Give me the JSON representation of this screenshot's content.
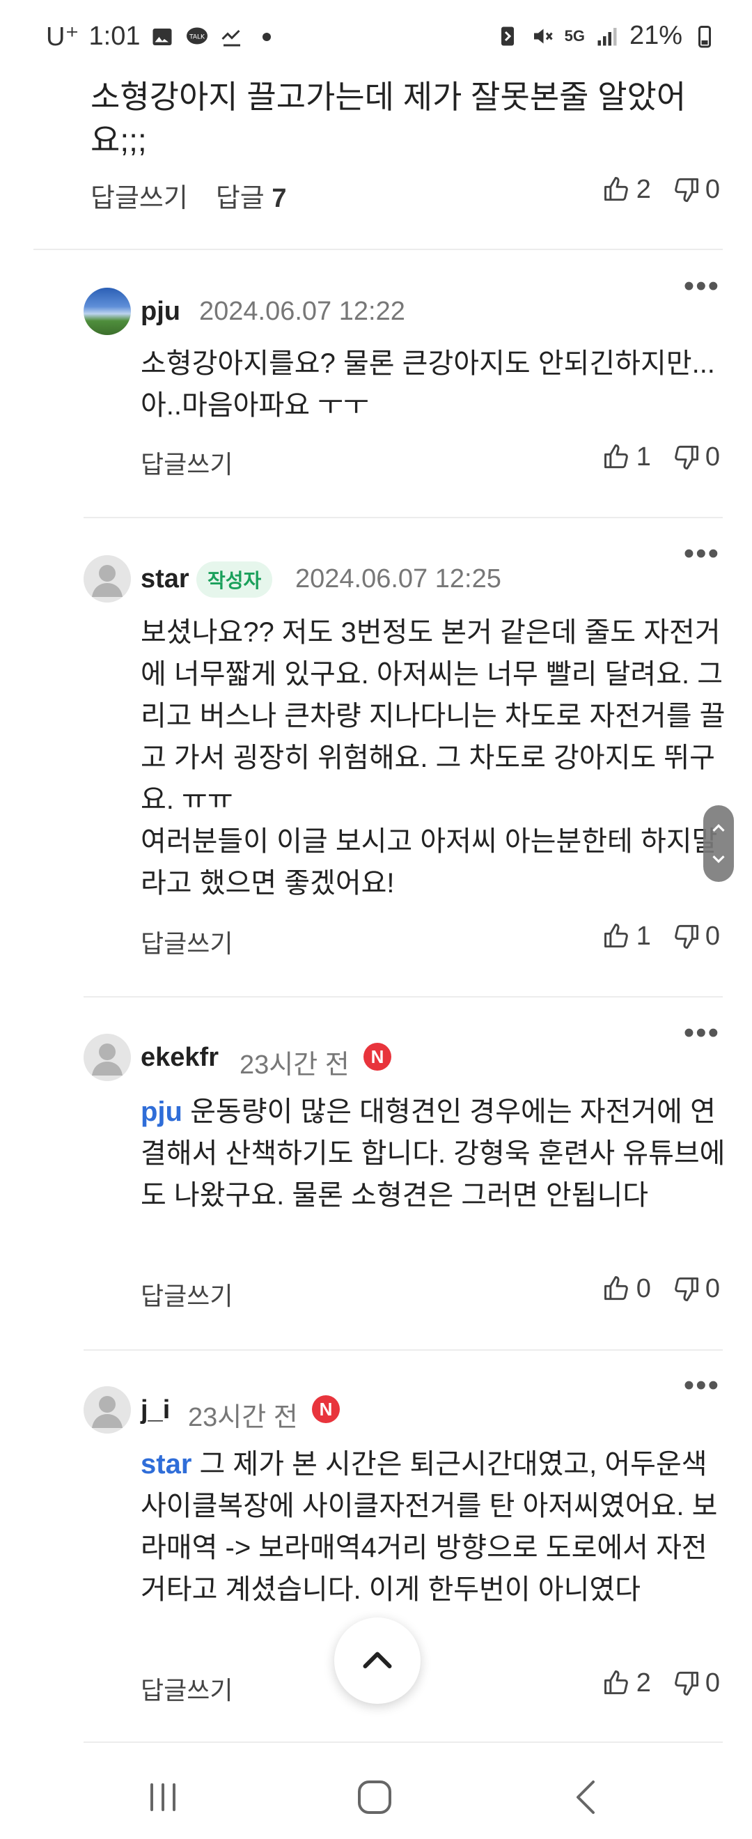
{
  "status": {
    "carrier": "U⁺",
    "time": "1:01",
    "battery": "21%",
    "network": "5G",
    "icons": [
      "image-icon",
      "talk-icon",
      "missed-call-icon",
      "dot-icon",
      "battery-saver-icon",
      "mute-icon",
      "signal-icon",
      "battery-icon"
    ],
    "talk_label": "TALK"
  },
  "top_comment": {
    "text": "소형강아지 끌고가는데 제가 잘못본줄 알았어요;;;",
    "reply_label": "답글쓰기",
    "replies_label": "답글",
    "replies_count": "7",
    "likes": "2",
    "dislikes": "0"
  },
  "comments": [
    {
      "author": "pju",
      "date": "2024.06.07 12:22",
      "text": "소형강아지를요? 물론 큰강아지도 안되긴하지만... 아..마음아파요 ㅜㅜ",
      "reply_label": "답글쓰기",
      "likes": "1",
      "dislikes": "0"
    },
    {
      "author": "star",
      "badge": "작성자",
      "date": "2024.06.07 12:25",
      "text": "보셨나요?? 저도 3번정도 본거 같은데 줄도 자전거에 너무짧게 있구요. 아저씨는 너무 빨리 달려요. 그리고 버스나 큰차량 지나다니는 차도로 자전거를 끌고 가서 굉장히 위험해요. 그 차도로 강아지도 뛰구요. ㅠㅠ",
      "text2": "여러분들이 이글 보시고 아저씨 아는분한테 하지말라고 했으면 좋겠어요!",
      "reply_label": "답글쓰기",
      "likes": "1",
      "dislikes": "0"
    },
    {
      "author": "ekekfr",
      "date": "23시간 전",
      "new": "N",
      "mention": "pju",
      "text": " 운동량이 많은 대형견인 경우에는 자전거에 연결해서 산책하기도 합니다. 강형욱 훈련사 유튜브에도 나왔구요. 물론 소형견은 그러면 안됩니다",
      "reply_label": "답글쓰기",
      "likes": "0",
      "dislikes": "0"
    },
    {
      "author": "j_i",
      "date": "23시간 전",
      "new": "N",
      "mention": "star",
      "text": " 그 제가 본 시간은 퇴근시간대였고, 어두운색 사이클복장에 사이클자전거를 탄 아저씨였어요. 보라매역 -> 보라매역4거리 방향으로 도로에서 자전거타고 계셨습니다. 이게 한두번이 아니였다",
      "reply_label": "답글쓰기",
      "likes": "2",
      "dislikes": "0"
    }
  ],
  "more_label": "•••",
  "scroll_up_icon": "chevron-up-icon",
  "nav": {
    "recent": "recent-apps-icon",
    "home": "home-icon",
    "back": "back-icon"
  }
}
